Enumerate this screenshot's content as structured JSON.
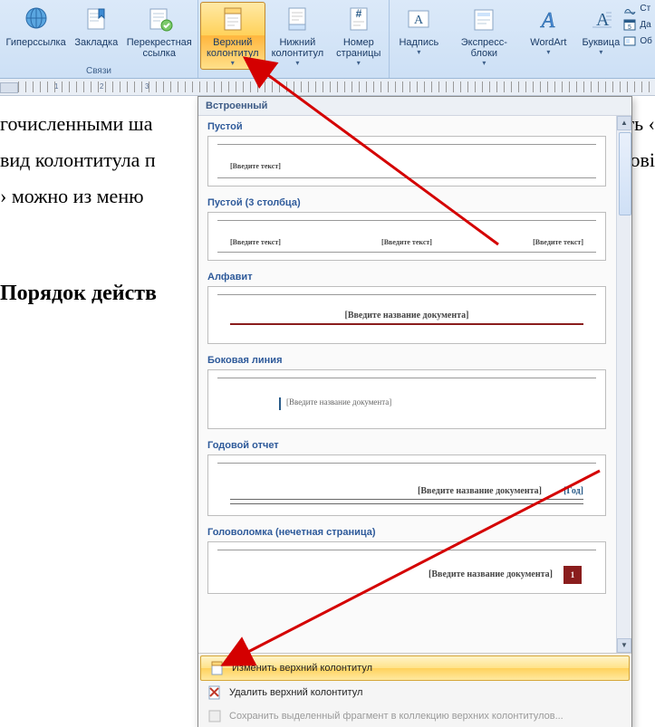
{
  "ribbon": {
    "group_links_label": "Связи",
    "hyperlink": "Гиперссылка",
    "bookmark": "Закладка",
    "crossref": "Перекрестная\nссылка",
    "header": "Верхний\nколонтитул",
    "footer": "Нижний\nколонтитул",
    "pagenum": "Номер\nстраницы",
    "textbox": "Надпись",
    "quickparts": "Экспресс-блоки",
    "wordart": "WordArt",
    "dropcap": "Буквица",
    "side_sig": "Ст",
    "side_date": "Да",
    "side_obj": "Об"
  },
  "document": {
    "line1": "гочисленными ша",
    "line2": "вид колонтитула п",
    "line3": "› можно из меню",
    "heading": "Порядок действ",
    "edge1": "ать ‹",
    "edge2": "лові"
  },
  "gallery": {
    "section_builtin": "Встроенный",
    "item1": {
      "title": "Пустой",
      "placeholder": "[Введите текст]"
    },
    "item2": {
      "title": "Пустой (3 столбца)",
      "placeholder": "[Введите текст]"
    },
    "item3": {
      "title": "Алфавит",
      "placeholder": "[Введите название документа]"
    },
    "item4": {
      "title": "Боковая линия",
      "placeholder": "[Введите название документа]"
    },
    "item5": {
      "title": "Годовой отчет",
      "placeholder": "[Введите название документа]",
      "year": "[Год]"
    },
    "item6": {
      "title": "Головоломка (нечетная страница)",
      "placeholder": "[Введите название документа]",
      "num": "1"
    }
  },
  "commands": {
    "edit": "Изменить верхний колонтитул",
    "delete": "Удалить верхний колонтитул",
    "save": "Сохранить выделенный фрагмент в коллекцию верхних колонтитулов..."
  }
}
